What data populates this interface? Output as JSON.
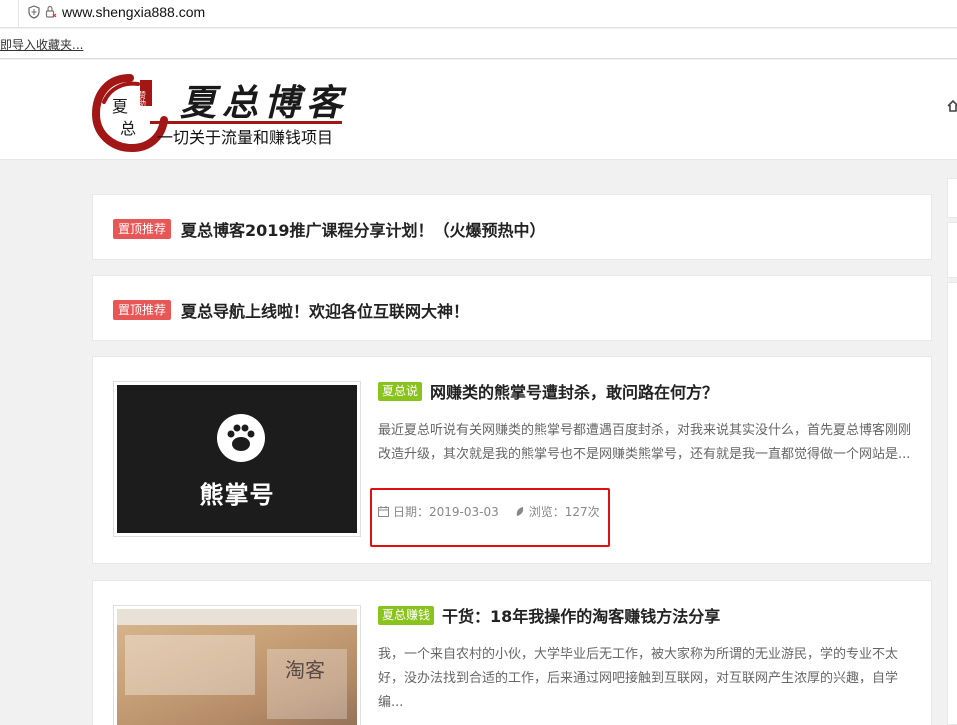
{
  "browser": {
    "url": "www.shengxia888.com",
    "bookmark_hint": "即导入收藏夹..."
  },
  "site": {
    "logo_title": "夏总博客",
    "slogan": "一切关于流量和赚钱项目",
    "logo_seal_chars": [
      "夏",
      "总"
    ],
    "logo_badge": "赞助"
  },
  "sticky_posts": [
    {
      "tag": "置顶推荐",
      "title": "夏总博客2019推广课程分享计划！（火爆预热中）"
    },
    {
      "tag": "置顶推荐",
      "title": "夏总导航上线啦！欢迎各位互联网大神！"
    }
  ],
  "posts": [
    {
      "category": "夏总说",
      "title": "网赚类的熊掌号遭封杀，敢问路在何方？",
      "excerpt": "最近夏总听说有关网赚类的熊掌号都遭遇百度封杀，对我来说其实没什么，首先夏总博客刚刚改造升级，其次就是我的熊掌号也不是网赚类熊掌号，还有就是我一直都觉得做一个网站是...",
      "date_label": "日期：2019-03-03",
      "views_label": "浏览：127次",
      "thumb_text": "熊掌号"
    },
    {
      "category": "夏总赚钱",
      "title": "干货：18年我操作的淘客赚钱方法分享",
      "excerpt": "我，一个来自农村的小伙，大学毕业后无工作，被大家称为所谓的无业游民，学的专业不太好，没办法找到合适的工作，后来通过网吧接触到互联网，对互联网产生浓厚的兴趣，自学编...",
      "thumb_text": "淘客"
    }
  ],
  "colors": {
    "tag_red": "#e85656",
    "tag_green": "#8ac31e",
    "highlight_box": "#e01010"
  }
}
